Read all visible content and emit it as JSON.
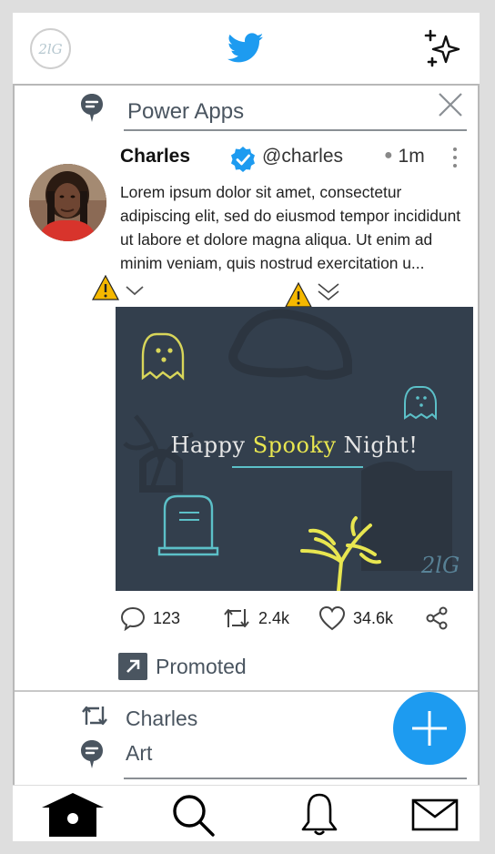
{
  "header": {
    "logo_text": "2lG",
    "bird_icon": "twitter-bird-icon",
    "sparkle_icon": "sparkle-icon",
    "brand_color": "#1d9bf0"
  },
  "topic_bar": {
    "value": "Power Apps",
    "icon": "topic-bubble-icon",
    "close_icon": "close-icon"
  },
  "tweet": {
    "name": "Charles",
    "handle": "@charles",
    "time": "1m",
    "verified_icon": "verified-badge-icon",
    "text": "Lorem ipsum dolor sit amet, consectetur adipiscing elit, sed do eiusmod tempor incididunt ut labore et dolore magna aliqua. Ut enim ad minim veniam, quis nostrud exercitation u...",
    "media": {
      "caption_pre": "Happy ",
      "caption_highlight": "Spooky",
      "caption_post": " Night!",
      "watermark": "2lG"
    },
    "actions": {
      "replies": "123",
      "retweets": "2.4k",
      "likes": "34.6k"
    },
    "promoted_label": "Promoted"
  },
  "next_tweet": {
    "retweeted_by": "Charles",
    "topic": "Art"
  },
  "nav": {
    "items": [
      "home-icon",
      "search-icon",
      "notifications-icon",
      "messages-icon"
    ]
  }
}
